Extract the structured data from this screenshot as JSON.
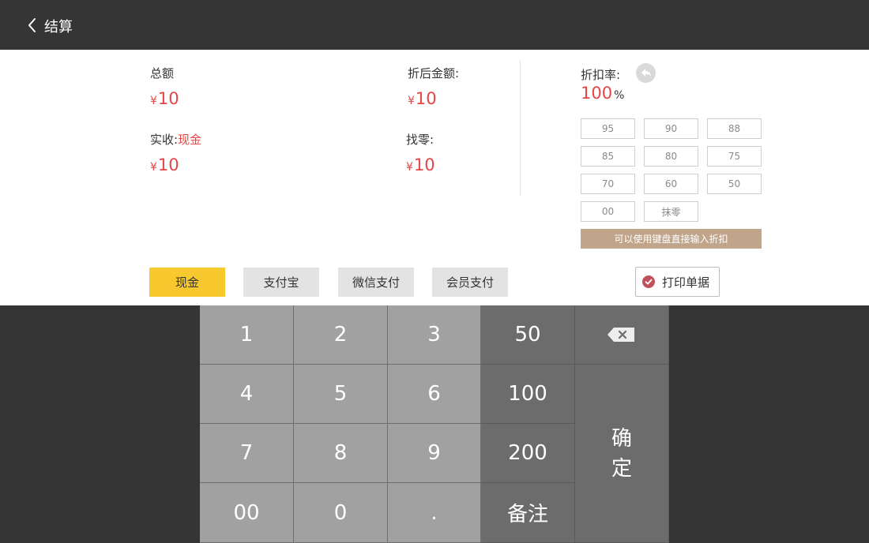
{
  "header": {
    "title": "结算",
    "back_icon": "chevron-left-icon"
  },
  "summary": {
    "currency": "¥",
    "total": {
      "label": "总额",
      "value": "10"
    },
    "discounted": {
      "label": "折后金额:",
      "value": "10"
    },
    "received": {
      "label": "实收:",
      "method": "现金",
      "value": "10"
    },
    "change": {
      "label": "找零:",
      "value": "10"
    }
  },
  "discount": {
    "label": "折扣率:",
    "value": "100",
    "unit": "%",
    "undo_icon": "undo-icon",
    "options": [
      "95",
      "90",
      "88",
      "85",
      "80",
      "75",
      "70",
      "60",
      "50",
      "00",
      "抹零"
    ],
    "hint": "可以使用键盘直接输入折扣"
  },
  "payment_methods": [
    {
      "label": "现金",
      "active": true
    },
    {
      "label": "支付宝",
      "active": false
    },
    {
      "label": "微信支付",
      "active": false
    },
    {
      "label": "会员支付",
      "active": false
    }
  ],
  "print": {
    "label": "打印单据",
    "checked": true,
    "icon": "check-circle-icon"
  },
  "keypad": {
    "keys": [
      "1",
      "2",
      "3",
      "50",
      "4",
      "5",
      "6",
      "100",
      "7",
      "8",
      "9",
      "200",
      "00",
      "0",
      ".",
      "备注"
    ],
    "delete_icon": "backspace-icon",
    "confirm_top": "确",
    "confirm_bottom": "定"
  },
  "colors": {
    "accent_red": "#e64545",
    "active_yellow": "#f8c82f",
    "hint_tan": "#c0a58b",
    "topbar": "#353535"
  }
}
